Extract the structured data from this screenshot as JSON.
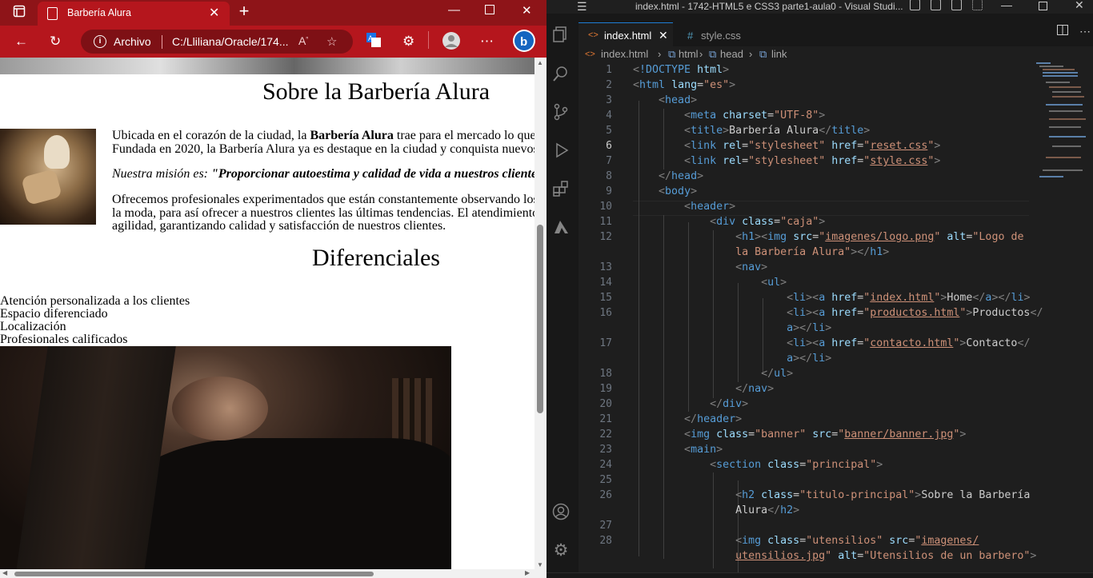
{
  "browser": {
    "tab_title": "Barbería Alura",
    "address_prefix": "Archivo",
    "address_path": "C:/Lliliana/Oracle/174...",
    "accent": "#b5161d"
  },
  "page": {
    "title_sobre": "Sobre la Barbería Alura",
    "p1_line1_a": "Ubicada en el corazón de la ciudad, la ",
    "p1_line1_bold": "Barbería Alura",
    "p1_line1_b": " trae para el mercado lo que",
    "p1_line2": "Fundada en 2020, la Barbería Alura ya es destaque en la ciudad y conquista nuevos",
    "mision_label": "Nuestra misión es:",
    "mision_text": " \"Proporcionar autoestima y calidad de vida a nuestros cliente",
    "p3_line1": "Ofrecemos profesionales experimentados que están constantemente observando los",
    "p3_line2": "la moda, para así ofrecer a nuestros clientes las últimas tendencias. El atendimiento",
    "p3_line3": "agilidad, garantizando calidad y satisfacción de nuestros clientes.",
    "title_dif": "Diferenciales",
    "diferenciales": [
      "Atención personalizada a los clientes",
      "Espacio diferenciado",
      "Localización",
      "Profesionales calificados"
    ]
  },
  "vscode": {
    "window_title": "index.html - 1742-HTML5 e CSS3 parte1-aula0 - Visual Studi...",
    "tabs": [
      {
        "label": "index.html",
        "icon": "<>",
        "active": true
      },
      {
        "label": "style.css",
        "icon": "#",
        "active": false
      }
    ],
    "breadcrumb": [
      "index.html",
      "html",
      "head",
      "link"
    ],
    "line_numbers": [
      "1",
      "2",
      "3",
      "4",
      "5",
      "6",
      "7",
      "8",
      "9",
      "10",
      "11",
      "12",
      "",
      "13",
      "14",
      "15",
      "16",
      "",
      "17",
      "",
      "18",
      "19",
      "20",
      "21",
      "22",
      "23",
      "24",
      "25",
      "26",
      "",
      "27",
      "28",
      ""
    ],
    "current_line": "6"
  }
}
